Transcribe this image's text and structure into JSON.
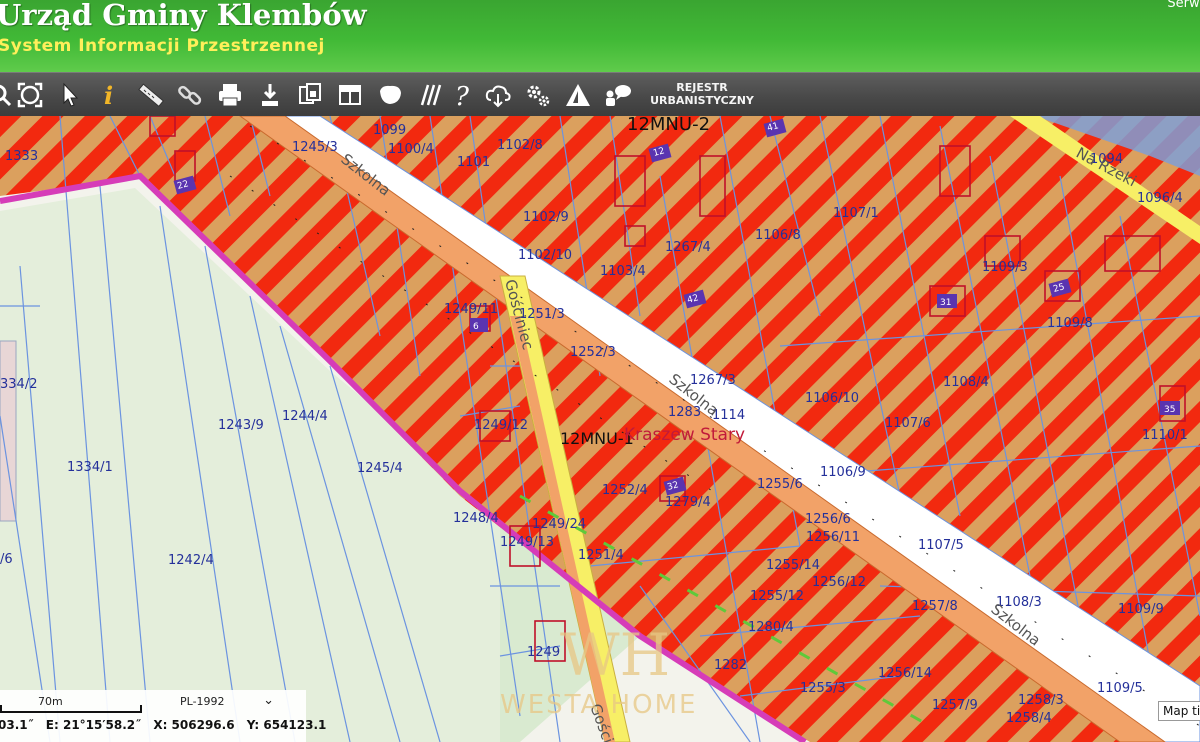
{
  "header": {
    "title": "Urząd Gminy Klembów",
    "subtitle": "System Informacji Przestrzennej",
    "services_link": "Serwis"
  },
  "toolbar": {
    "tools": [
      {
        "name": "zoom-in-tool",
        "icon": "magnifier-icon"
      },
      {
        "name": "full-extent-tool",
        "icon": "full-extent-icon"
      },
      {
        "name": "select-tool",
        "icon": "arrow-cursor-icon"
      },
      {
        "name": "info-tool",
        "icon": "info-icon"
      },
      {
        "name": "measure-tool",
        "icon": "ruler-icon"
      },
      {
        "name": "link-tool",
        "icon": "chain-link-icon"
      },
      {
        "name": "print-tool",
        "icon": "printer-icon"
      },
      {
        "name": "download-tool",
        "icon": "download-icon"
      },
      {
        "name": "copy-tool",
        "icon": "copy-icon"
      },
      {
        "name": "layout-tool",
        "icon": "layout-icon"
      },
      {
        "name": "shape-tool",
        "icon": "polygon-icon"
      },
      {
        "name": "hatch-tool",
        "icon": "hatch-icon"
      },
      {
        "name": "help-tool",
        "icon": "question-icon"
      },
      {
        "name": "cloud-download-tool",
        "icon": "cloud-download-icon"
      },
      {
        "name": "settings-tool",
        "icon": "gears-icon"
      },
      {
        "name": "warning-tool",
        "icon": "warning-icon"
      },
      {
        "name": "comment-tool",
        "icon": "user-comment-icon"
      }
    ],
    "registry_line1": "REJESTR",
    "registry_line2": "URBANISTYCZNY"
  },
  "map": {
    "colors": {
      "hatch_red": "#f2290f",
      "hatch_tan": "#dba05e",
      "boundary": "#d63cb8",
      "road": "#f2a268",
      "green_area": "#e4eedb"
    },
    "zone_labels": [
      "12MNU-2",
      "12MNU-1"
    ],
    "place_name": "Kraszew Stary",
    "road_labels": [
      "Szkolna",
      "Gościniec",
      "Na Rzeki",
      "Szkolna",
      "Szkolna",
      "Gościn"
    ],
    "parcel_labels": [
      "1333",
      "1099",
      "1100/4",
      "1245/3",
      "1102/8",
      "1101",
      "1094",
      "1096/4",
      "1102/9",
      "1107/1",
      "1106/8",
      "1267/4",
      "1102/10",
      "1103/4",
      "1109/3",
      "1249/11",
      "1251/3",
      "1109/8",
      "1252/3",
      "1267/3",
      "334/2",
      "1108/4",
      "1106/10",
      "1244/4",
      "1243/9",
      "1249/12",
      "1283",
      "1114",
      "1107/6",
      "1110/1",
      "1334/1",
      "1245/4",
      "1106/9",
      "1252/4",
      "1279/4",
      "1255/6",
      "1248/4",
      "1249/24",
      "1256/6",
      "1256/11",
      "1249/13",
      "1107/5",
      "1251/4",
      "/6",
      "1242/4",
      "1255/14",
      "1256/12",
      "1255/12",
      "1257/8",
      "1108/3",
      "1109/9",
      "1280/4",
      "1249",
      "1282",
      "1256/14",
      "1255/3",
      "1109/5",
      "1257/9",
      "1258/3",
      "1258/4"
    ],
    "building_numbers": [
      "22",
      "12",
      "42",
      "31",
      "25",
      "6",
      "35",
      "32",
      "41"
    ]
  },
  "scale": {
    "label": "70m",
    "crs": "PL-1992",
    "lat_fragment": "03.1˝",
    "lon": "E: 21°15′58.2˝",
    "x": "X: 506296.6",
    "y": "Y: 654123.1"
  },
  "map_tip": "Map ti",
  "watermark": {
    "mark": "WH",
    "text": "WESTA HOME"
  }
}
